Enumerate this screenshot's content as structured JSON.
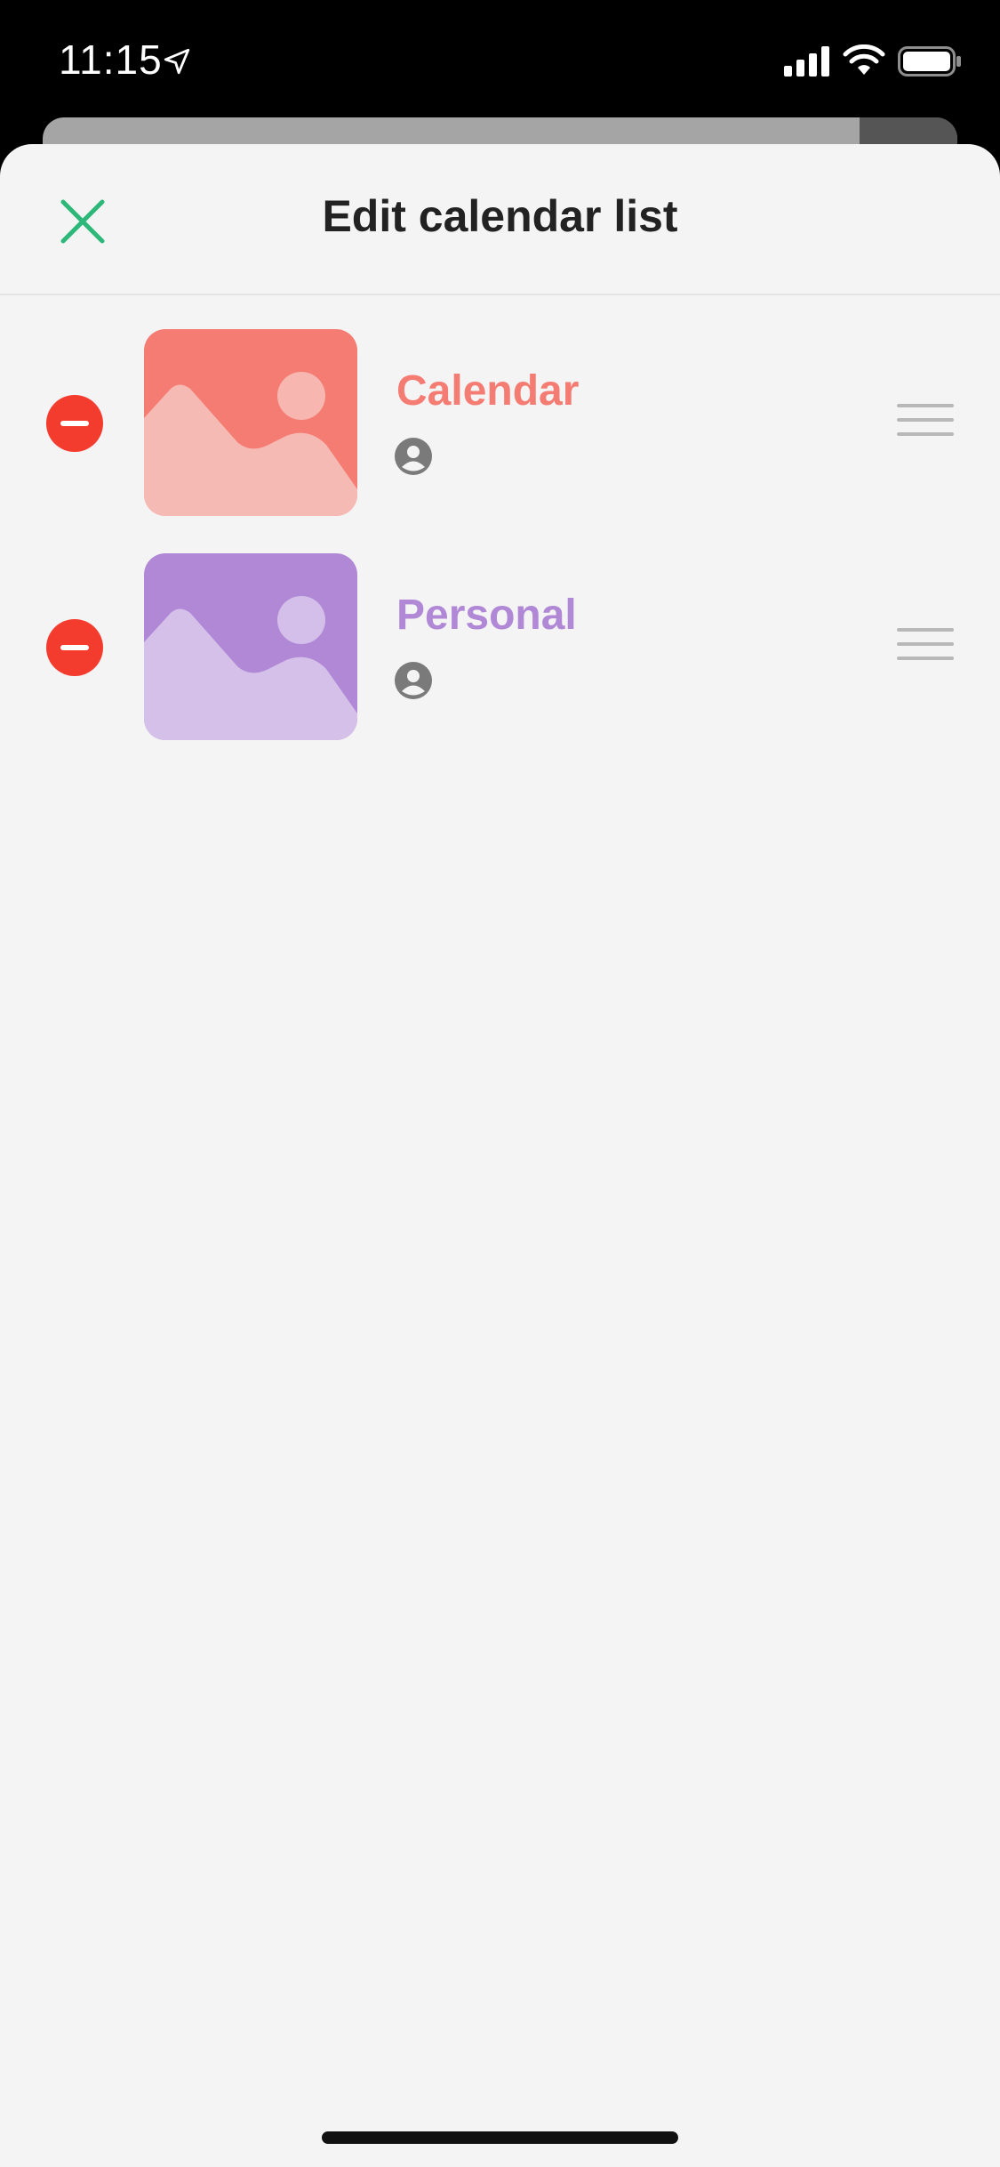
{
  "status_bar": {
    "time": "11:15",
    "icons": [
      "location-arrow-icon",
      "cellular-signal-icon",
      "wifi-icon",
      "battery-icon"
    ]
  },
  "header": {
    "title": "Edit calendar list",
    "close_icon": "close-icon",
    "accent_color": "#2db87a"
  },
  "calendars": [
    {
      "name": "Calendar",
      "color": "#f47c72",
      "icon": "person-icon"
    },
    {
      "name": "Personal",
      "color": "#b088d6",
      "icon": "person-icon"
    }
  ],
  "colors": {
    "delete": "#f33b2e",
    "background": "#f4f4f4",
    "title_text": "#222222"
  }
}
